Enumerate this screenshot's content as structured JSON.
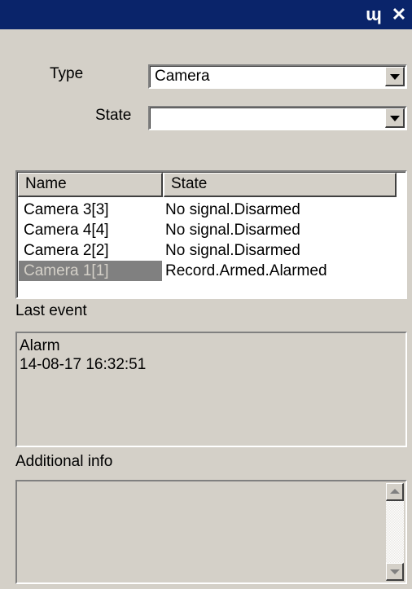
{
  "titlebar": {
    "pin_glyph": "ɰ",
    "close_glyph": "✕",
    "color": "#0a246a"
  },
  "filters": {
    "type_label": "Type",
    "type_value": "Camera",
    "state_label": "State",
    "state_value": ""
  },
  "objects_list": {
    "columns": [
      "Name",
      "State"
    ],
    "rows": [
      {
        "name": "Camera 3[3]",
        "state": "No signal.Disarmed"
      },
      {
        "name": "Camera 4[4]",
        "state": "No signal.Disarmed"
      },
      {
        "name": "Camera 2[2]",
        "state": "No signal.Disarmed"
      },
      {
        "name": "Camera 1[1]",
        "state": "Record.Armed.Alarmed",
        "selected": true
      }
    ]
  },
  "last_event": {
    "label": "Last event",
    "type": "Alarm",
    "time": "14-08-17 16:32:51"
  },
  "additional_info": {
    "label": "Additional info",
    "text": ""
  }
}
